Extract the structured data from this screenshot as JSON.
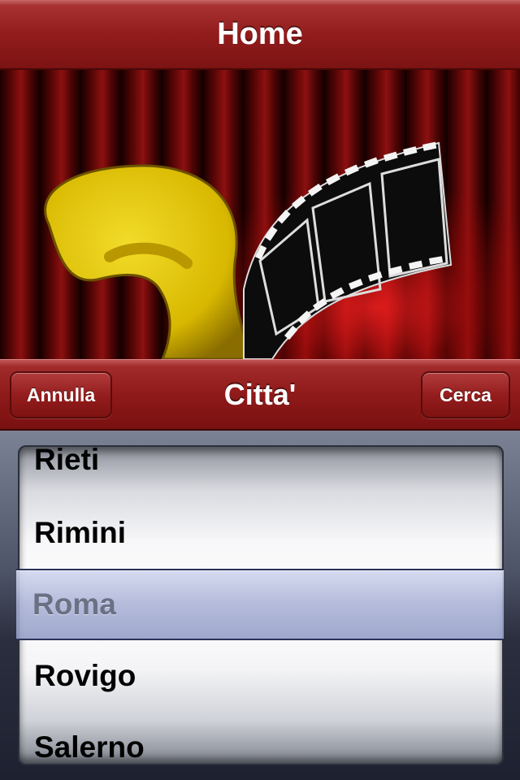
{
  "navbar": {
    "title": "Home"
  },
  "toolbar": {
    "cancel_label": "Annulla",
    "title": "Citta'",
    "search_label": "Cerca"
  },
  "picker": {
    "items": [
      "Rieti",
      "Rimini",
      "Roma",
      "Rovigo",
      "Salerno"
    ],
    "selected": "Roma"
  },
  "colors": {
    "bar_red": "#921c1c",
    "selection_blue": "#aab2d6"
  }
}
